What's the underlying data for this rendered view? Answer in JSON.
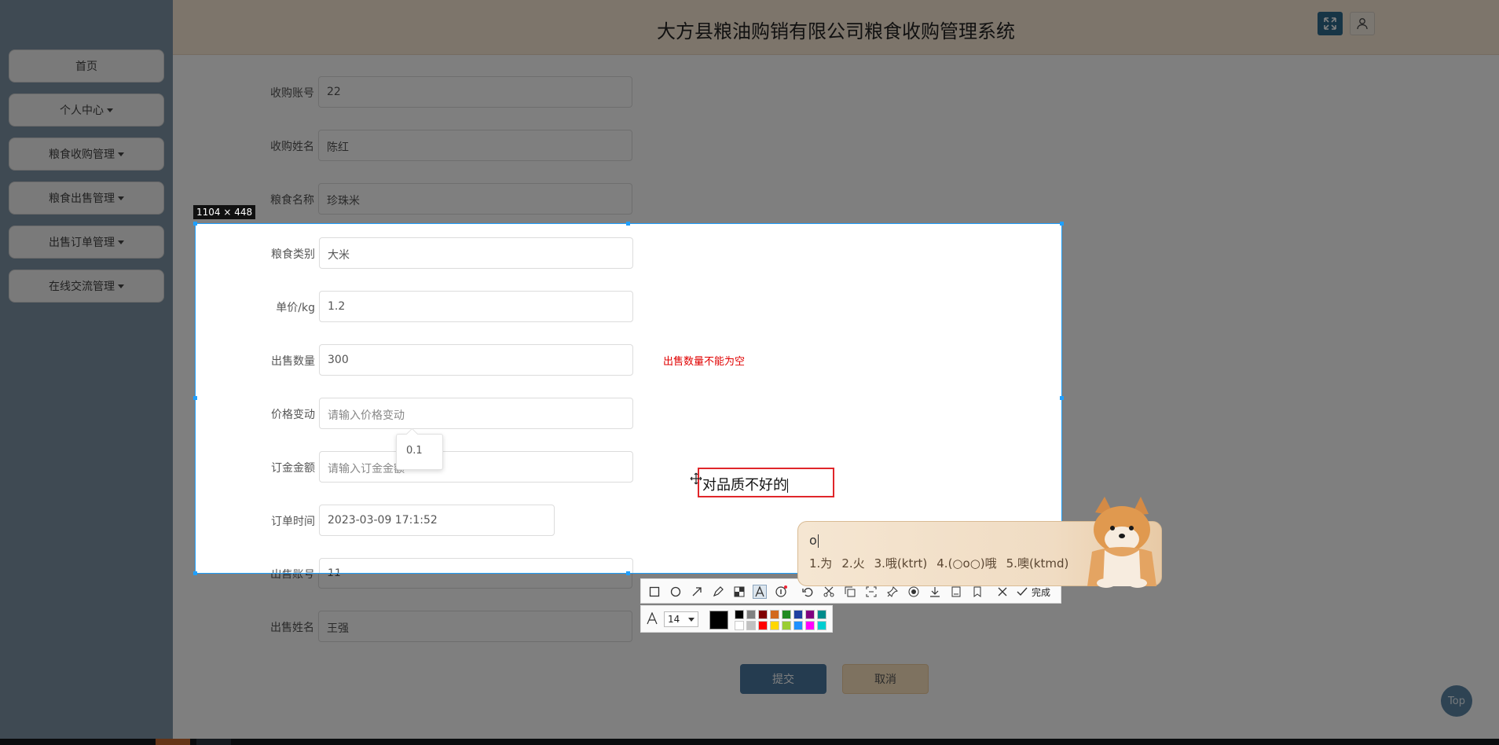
{
  "app": {
    "title": "大方县粮油购销有限公司粮食收购管理系统"
  },
  "sidebar": {
    "items": [
      {
        "label": "首页",
        "dropdown": false
      },
      {
        "label": "个人中心",
        "dropdown": true
      },
      {
        "label": "粮食收购管理",
        "dropdown": true
      },
      {
        "label": "粮食出售管理",
        "dropdown": true
      },
      {
        "label": "出售订单管理",
        "dropdown": true
      },
      {
        "label": "在线交流管理",
        "dropdown": true
      }
    ]
  },
  "header": {
    "expand_icon": "expand-icon",
    "user_icon": "user-icon"
  },
  "form": {
    "fields": [
      {
        "label": "收购账号",
        "value": "22",
        "placeholder": ""
      },
      {
        "label": "收购姓名",
        "value": "陈红",
        "placeholder": ""
      },
      {
        "label": "粮食名称",
        "value": "珍珠米",
        "placeholder": ""
      },
      {
        "label": "粮食类别",
        "value": "大米",
        "placeholder": ""
      },
      {
        "label": "单价/kg",
        "value": "1.2",
        "placeholder": ""
      },
      {
        "label": "出售数量",
        "value": "300",
        "placeholder": ""
      },
      {
        "label": "价格变动",
        "value": "",
        "placeholder": "请输入价格变动"
      },
      {
        "label": "订金金额",
        "value": "",
        "placeholder": "请输入订金金额"
      },
      {
        "label": "订单时间",
        "value": "2023-03-09 17:1:52",
        "placeholder": ""
      },
      {
        "label": "出售账号",
        "value": "11",
        "placeholder": ""
      },
      {
        "label": "出售姓名",
        "value": "王强",
        "placeholder": ""
      }
    ],
    "error_quantity": "出售数量不能为空",
    "tooltip_value": "0.1",
    "submit_label": "提交",
    "cancel_label": "取消"
  },
  "top_button": "Top",
  "screenshot_tool": {
    "size_label": "1104 × 448",
    "annotation_text": "对品质不好的",
    "done_label": "完成",
    "font_size": "14",
    "current_color": "#000000",
    "palette": [
      "#000000",
      "#808080",
      "#800000",
      "#d2691e",
      "#228b22",
      "#1e3fa0",
      "#800080",
      "#008b8b",
      "#ffffff",
      "#c0c0c0",
      "#ff0000",
      "#ffd700",
      "#9acd32",
      "#1e90ff",
      "#ff00ff",
      "#00ced1"
    ],
    "tools": [
      "rectangle-icon",
      "ellipse-icon",
      "arrow-icon",
      "pen-icon",
      "mosaic-icon",
      "text-icon",
      "number-icon",
      "undo-icon",
      "cut-icon",
      "copy-icon",
      "pin-icon",
      "record-icon",
      "download-icon",
      "save-icon",
      "bookmark-icon",
      "close-icon",
      "check-icon"
    ]
  },
  "ime": {
    "composition": "o",
    "candidates": [
      "1.为",
      "2.火",
      "3.哦(ktrt)",
      "4.(○o○)哦",
      "5.噢(ktmd)"
    ]
  }
}
